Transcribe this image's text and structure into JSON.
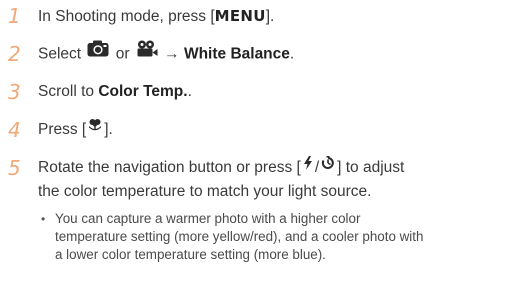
{
  "steps": [
    {
      "num": "1",
      "pre": "In Shooting mode, press [",
      "key": "MENU",
      "post": "]."
    },
    {
      "num": "2",
      "pre": "Select",
      "mid": "or",
      "arrow": "→",
      "bold": "White Balance",
      "post": ".",
      "icons": [
        "camera-icon",
        "movie-icon"
      ]
    },
    {
      "num": "3",
      "pre": "Scroll to",
      "bold": "Color Temp.",
      "post": "."
    },
    {
      "num": "4",
      "pre": "Press [",
      "post": "].",
      "icons": [
        "macro-flower-icon"
      ]
    },
    {
      "num": "5",
      "line1_pre": "Rotate the navigation button or press [",
      "line1_sep": "/",
      "line1_post": "] to adjust",
      "line2": "the color temperature to match your light source.",
      "icons": [
        "flash-icon",
        "self-timer-icon"
      ]
    }
  ],
  "note": {
    "bullet": "•",
    "line1": "You can capture a warmer photo with a higher color",
    "line2": "temperature setting (more yellow/red), and a cooler photo with",
    "line3": "a lower color temperature setting (more blue)."
  }
}
